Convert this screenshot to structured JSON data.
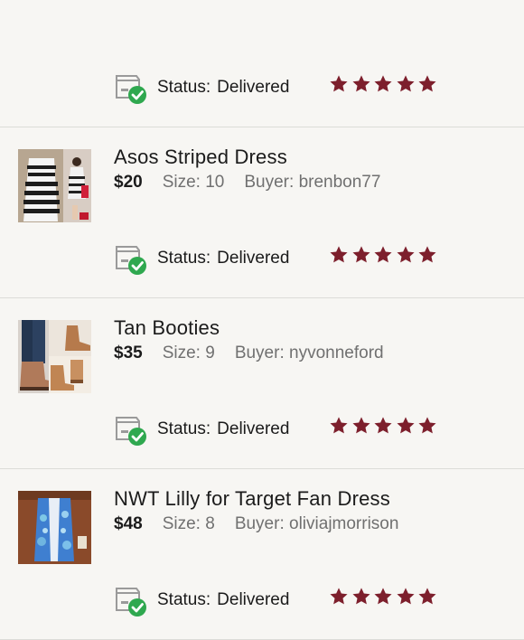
{
  "orders": [
    {
      "title": "",
      "price": "",
      "size_label": "",
      "size_value": "",
      "buyer_label": "",
      "buyer_value": "",
      "status_label": "Status:",
      "status_value": "Delivered",
      "rating": 5,
      "thumb": "none"
    },
    {
      "title": "Asos Striped Dress",
      "price": "$20",
      "size_label": "Size:",
      "size_value": "10",
      "buyer_label": "Buyer:",
      "buyer_value": "brenbon77",
      "status_label": "Status:",
      "status_value": "Delivered",
      "rating": 5,
      "thumb": "striped-dress"
    },
    {
      "title": "Tan Booties",
      "price": "$35",
      "size_label": "Size:",
      "size_value": "9",
      "buyer_label": "Buyer:",
      "buyer_value": "nyvonneford",
      "status_label": "Status:",
      "status_value": "Delivered",
      "rating": 5,
      "thumb": "booties"
    },
    {
      "title": "NWT Lilly for Target Fan Dress",
      "price": "$48",
      "size_label": "Size:",
      "size_value": "8",
      "buyer_label": "Buyer:",
      "buyer_value": "oliviajmorrison",
      "status_label": "Status:",
      "status_value": "Delivered",
      "rating": 5,
      "thumb": "blue-dress"
    }
  ],
  "colors": {
    "star": "#7d1f2c",
    "check_green": "#2fa84f",
    "package_gray": "#9a9a9a"
  },
  "icons": {
    "status": "package-delivered-icon",
    "rating": "star-icon"
  }
}
